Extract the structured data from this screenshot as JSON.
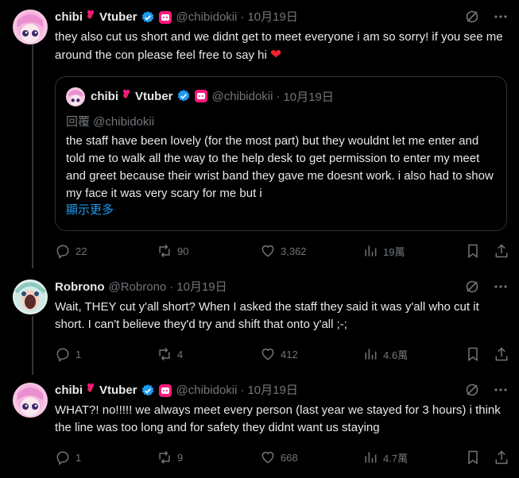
{
  "tweets": [
    {
      "name": "chibi",
      "name_suffix": "Vtuber",
      "handle": "@chibidokii",
      "date": "10月19日",
      "text": "they also cut us short and we didnt get to meet everyone i am so sorry! if you see me around the con please feel free to say hi",
      "replies": "22",
      "reposts": "90",
      "likes": "3,362",
      "views": "19萬"
    },
    {
      "name": "Robrono",
      "handle": "@Robrono",
      "date": "10月19日",
      "text": "Wait, THEY cut y'all short? When I asked the staff they said it was y'all who cut it short. I can't believe they'd try and shift that onto y'all ;-;",
      "replies": "1",
      "reposts": "4",
      "likes": "412",
      "views": "4.6萬"
    },
    {
      "name": "chibi",
      "name_suffix": "Vtuber",
      "handle": "@chibidokii",
      "date": "10月19日",
      "text": "WHAT?! no!!!!! we always meet every person (last year we stayed for 3 hours) i think the line was too long and for safety they didnt want us staying",
      "replies": "1",
      "reposts": "9",
      "likes": "668",
      "views": "4.7萬"
    }
  ],
  "quote": {
    "name": "chibi",
    "name_suffix": "Vtuber",
    "handle": "@chibidokii",
    "date": "10月19日",
    "reply_to": "回覆 @chibidokii",
    "text": "the staff have been lovely (for the most part) but they wouldnt let me enter and told me to walk all the way to the help desk to get permission to enter my meet and greet because their wrist band they gave me doesnt work. i also had to show my face it was very scary for me but i",
    "show_more": "顯示更多"
  },
  "colors": {
    "background": "#000000",
    "text": "#e7e9ea",
    "muted": "#71767b",
    "link": "#1d9bf0",
    "verified": "#1d9bf0",
    "heart": "#f4212e",
    "border": "#2f3336"
  }
}
